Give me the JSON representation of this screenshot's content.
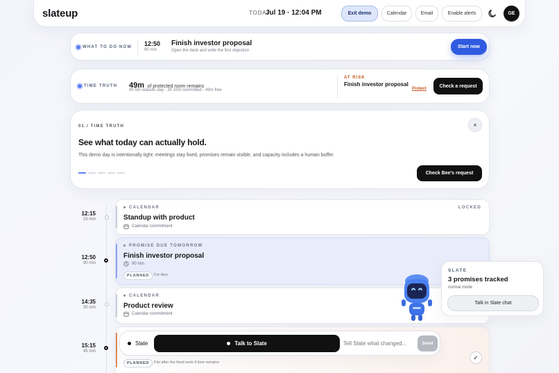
{
  "header": {
    "logo": "slateup",
    "today_label": "TODAY",
    "datetime": "Jul 19 · 12:04 PM",
    "buttons": {
      "exit_demo": "Exit demo",
      "calendar": "Calendar",
      "email": "Email",
      "enable_alerts": "Enable alerts"
    },
    "avatar_initials": "GE"
  },
  "todo": {
    "label": "WHAT TO DO NOW",
    "time": "12:50",
    "duration": "90 min",
    "title": "Finish investor proposal",
    "subtitle": "Open the deck and write the first objection",
    "cta": "Start now"
  },
  "truth": {
    "label": "TIME TRUTH",
    "big": "49m",
    "big_suffix": "of protected room remains",
    "sub": "4h 5m realistic day · 3h 10m committed · 49m free",
    "risk_label": "AT RISK",
    "risk_title": "Finish investor proposal",
    "protect": "Protect",
    "cta": "Check a request"
  },
  "story": {
    "step_label": "01 / TIME TRUTH",
    "title": "See what today can actually hold.",
    "body": "This demo day is intentionally tight: meetings stay fixed, promises remain visible, and capacity includes a human buffer.",
    "close": "×",
    "cta": "Check Bee's request"
  },
  "timeline": [
    {
      "time": "12:15",
      "dur": "25 min",
      "kicker": "CALENDAR",
      "title": "Standup with product",
      "meta": "Calendar commitment",
      "badge": "LOCKED"
    },
    {
      "time": "12:50",
      "dur": "90 min",
      "kicker": "PROMISE DUE TOMORROW",
      "title": "Finish investor proposal",
      "meta": "90 min",
      "chip": "PLANNED",
      "chip_note": "For Alex"
    },
    {
      "time": "14:35",
      "dur": "30 min",
      "kicker": "CALENDAR",
      "title": "Product review",
      "meta": "Calendar commitment"
    },
    {
      "time": "15:15",
      "dur": "45 min",
      "chip": "PLANNED",
      "chip_note": "Fits after the fixed work if time remains"
    }
  ],
  "slate_pop": {
    "label": "SLATE",
    "title": "3 promises tracked",
    "mode": "normal mode",
    "cta": "Talk in Slate chat"
  },
  "chat": {
    "label": "Slate",
    "talk": "Talk to Slate",
    "placeholder": "Tell Slate what changed...",
    "send": "Send"
  },
  "colors": {
    "accent_blue": "#2f5be0",
    "risk_orange": "#c2561b",
    "highlight_row": "#e9edfb"
  }
}
